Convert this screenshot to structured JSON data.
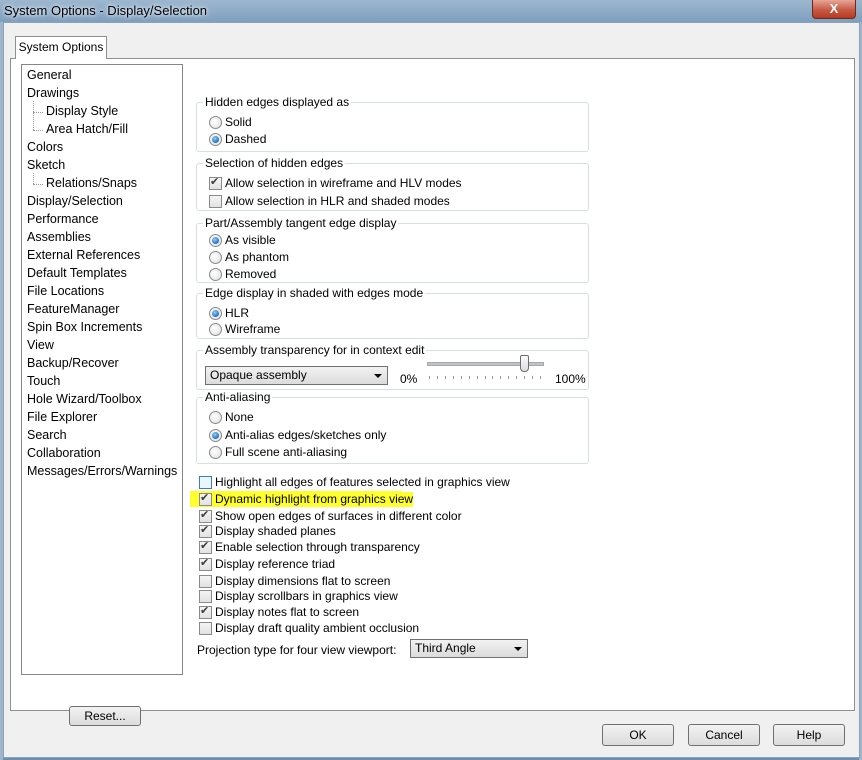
{
  "window": {
    "title": "System Options - Display/Selection",
    "close_label": "X"
  },
  "tab": {
    "label": "System Options"
  },
  "tree": {
    "items": [
      {
        "label": "General",
        "sub": false
      },
      {
        "label": "Drawings",
        "sub": false
      },
      {
        "label": "Display Style",
        "sub": true
      },
      {
        "label": "Area Hatch/Fill",
        "sub": true
      },
      {
        "label": "Colors",
        "sub": false
      },
      {
        "label": "Sketch",
        "sub": false
      },
      {
        "label": "Relations/Snaps",
        "sub": true
      },
      {
        "label": "Display/Selection",
        "sub": false,
        "selected": true
      },
      {
        "label": "Performance",
        "sub": false
      },
      {
        "label": "Assemblies",
        "sub": false
      },
      {
        "label": "External References",
        "sub": false
      },
      {
        "label": "Default Templates",
        "sub": false
      },
      {
        "label": "File Locations",
        "sub": false
      },
      {
        "label": "FeatureManager",
        "sub": false
      },
      {
        "label": "Spin Box Increments",
        "sub": false
      },
      {
        "label": "View",
        "sub": false
      },
      {
        "label": "Backup/Recover",
        "sub": false
      },
      {
        "label": "Touch",
        "sub": false
      },
      {
        "label": "Hole Wizard/Toolbox",
        "sub": false
      },
      {
        "label": "File Explorer",
        "sub": false
      },
      {
        "label": "Search",
        "sub": false
      },
      {
        "label": "Collaboration",
        "sub": false
      },
      {
        "label": "Messages/Errors/Warnings",
        "sub": false
      }
    ],
    "reset_label": "Reset..."
  },
  "hidden_edges": {
    "title": "Hidden edges displayed as",
    "options": [
      {
        "label": "Solid",
        "selected": false
      },
      {
        "label": "Dashed",
        "selected": true
      }
    ]
  },
  "selection_hidden": {
    "title": "Selection of hidden edges",
    "options": [
      {
        "label": "Allow selection in wireframe and HLV modes",
        "checked": true
      },
      {
        "label": "Allow selection in HLR and shaded modes",
        "checked": false
      }
    ]
  },
  "tangent_edge": {
    "title": "Part/Assembly tangent edge display",
    "options": [
      {
        "label": "As visible",
        "selected": true
      },
      {
        "label": "As phantom",
        "selected": false
      },
      {
        "label": "Removed",
        "selected": false
      }
    ]
  },
  "edge_shaded": {
    "title": "Edge display in shaded with edges mode",
    "options": [
      {
        "label": "HLR",
        "selected": true
      },
      {
        "label": "Wireframe",
        "selected": false
      }
    ]
  },
  "assembly_transparency": {
    "title": "Assembly transparency for in context edit",
    "dropdown_value": "Opaque assembly",
    "min_label": "0%",
    "max_label": "100%",
    "slider_value_percent": 86
  },
  "anti_aliasing": {
    "title": "Anti-aliasing",
    "options": [
      {
        "label": "None",
        "selected": false
      },
      {
        "label": "Anti-alias edges/sketches only",
        "selected": true
      },
      {
        "label": "Full scene anti-aliasing",
        "selected": false
      }
    ]
  },
  "checks": [
    {
      "label": "Highlight all edges of features selected in graphics view",
      "checked": false,
      "focus": true
    },
    {
      "label": "Dynamic highlight from graphics view",
      "checked": true,
      "highlight": true
    },
    {
      "label": "Show open edges of surfaces in different color",
      "checked": true
    },
    {
      "label": "Display shaded planes",
      "checked": true
    },
    {
      "label": "Enable selection through transparency",
      "checked": true
    },
    {
      "label": "Display reference triad",
      "checked": true
    },
    {
      "label": "Display dimensions flat to screen",
      "checked": false
    },
    {
      "label": "Display scrollbars in graphics view",
      "checked": false
    },
    {
      "label": "Display notes flat to screen",
      "checked": true
    },
    {
      "label": "Display draft quality ambient occlusion",
      "checked": false
    }
  ],
  "projection": {
    "label": "Projection type for four view viewport:",
    "value": "Third Angle"
  },
  "buttons": {
    "ok": "OK",
    "cancel": "Cancel",
    "help": "Help"
  }
}
